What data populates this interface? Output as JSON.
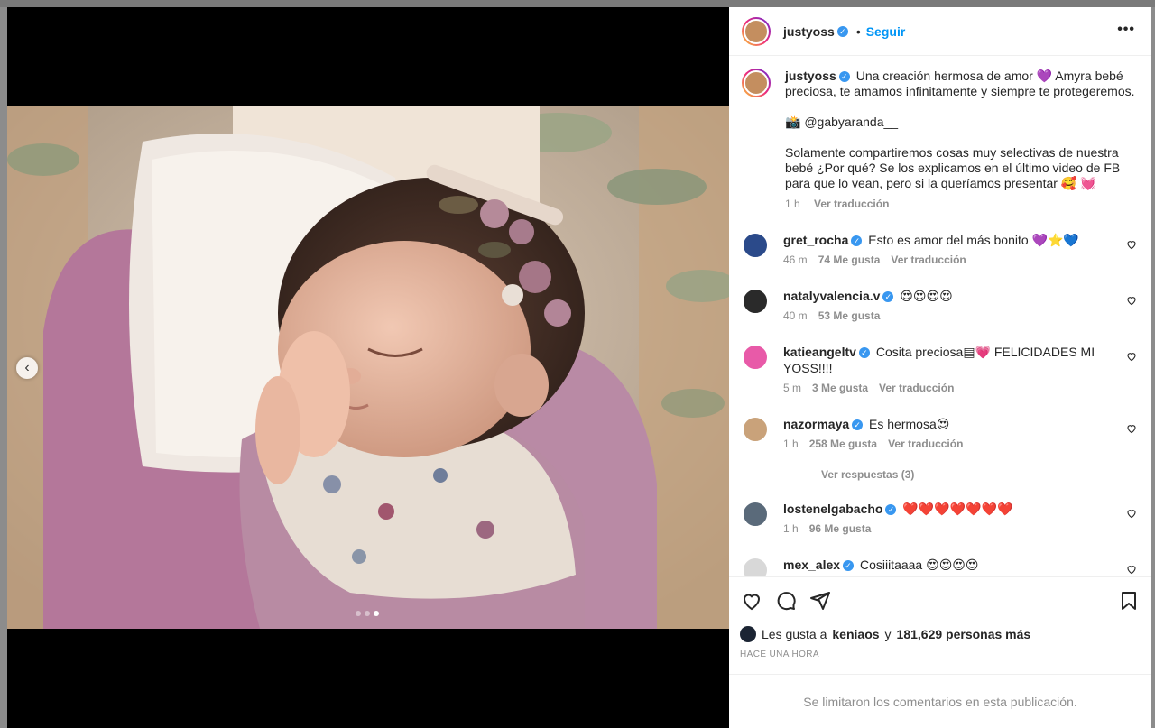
{
  "post": {
    "author": "justyoss",
    "follow_label": "Seguir",
    "separator": "•",
    "more_label": "•••",
    "caption": {
      "line1": "Una creación hermosa de amor 💜 Amyra bebé preciosa, te amamos infinitamente y siempre te protegeremos.",
      "line2": "📸 @gabyaranda__",
      "line3": "Solamente compartiremos cosas muy selectivas de nuestra bebé ¿Por qué? Se los explicamos en el último video de FB para que lo vean, pero si la queríamos presentar 🥰 💓",
      "time": "1 h",
      "translate": "Ver traducción"
    }
  },
  "comments": [
    {
      "user": "gret_rocha",
      "text": "Esto es amor del más bonito 💜⭐💙",
      "time": "46 m",
      "likes": "74 Me gusta",
      "translate": "Ver traducción",
      "avatar_color": "#2b4a8a"
    },
    {
      "user": "natalyvalencia.v",
      "text": "😍😍😍😍",
      "time": "40 m",
      "likes": "53 Me gusta",
      "translate": "",
      "avatar_color": "#2a2a2a"
    },
    {
      "user": "katieangeltv",
      "text": "Cosita preciosa▤💗 FELICIDADES MI YOSS!!!!",
      "time": "5 m",
      "likes": "3 Me gusta",
      "translate": "Ver traducción",
      "avatar_color": "#e85aa8"
    },
    {
      "user": "nazormaya",
      "text": "Es hermosa😍",
      "time": "1 h",
      "likes": "258 Me gusta",
      "translate": "Ver traducción",
      "avatar_color": "#c9a27a"
    },
    {
      "user": "lostenelgabacho",
      "text": "❤️❤️❤️❤️❤️❤️❤️",
      "time": "1 h",
      "likes": "96 Me gusta",
      "translate": "",
      "avatar_color": "#5a6a7a"
    },
    {
      "user": "mex_alex",
      "text": "Cosiiitaaaa 😍😍😍😍",
      "time": "",
      "likes": "",
      "translate": "",
      "avatar_color": "#d8d8d8"
    }
  ],
  "replies_label": "Ver respuestas (3)",
  "likes": {
    "prefix": "Les gusta a",
    "user": "keniaos",
    "joiner": "y",
    "count": "181,629 personas más"
  },
  "time_ago": "HACE UNA HORA",
  "limited_comments": "Se limitaron los comentarios en esta publicación.",
  "carousel": {
    "count": 3,
    "active": 3
  }
}
